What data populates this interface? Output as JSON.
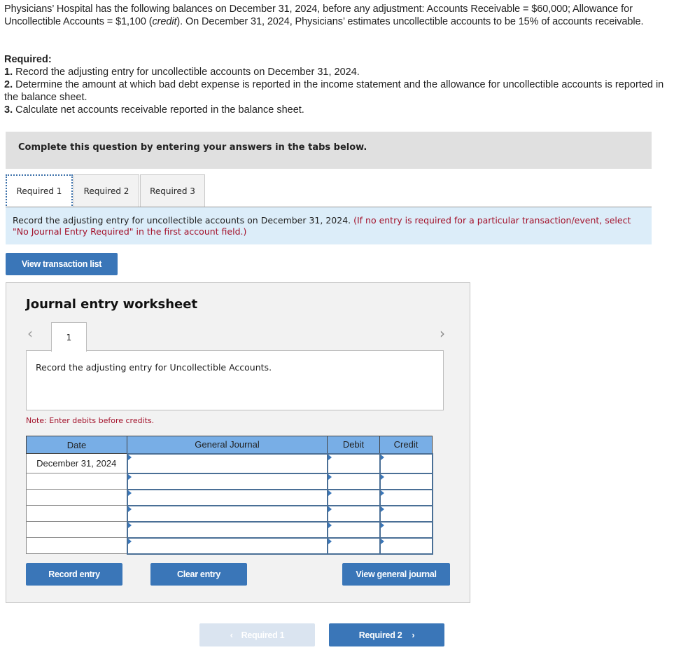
{
  "problem": {
    "text_before_italic": "Physicians’ Hospital has the following balances on December 31, 2024, before any adjustment: Accounts Receivable = $60,000; Allowance for Uncollectible Accounts = $1,100 (",
    "italic": "credit",
    "text_after_italic": "). On December 31, 2024, Physicians’ estimates uncollectible accounts to be 15% of accounts receivable."
  },
  "required": {
    "heading": "Required:",
    "items": [
      {
        "num": "1.",
        "text": " Record the adjusting entry for uncollectible accounts on December 31, 2024."
      },
      {
        "num": "2.",
        "text": " Determine the amount at which bad debt expense is reported in the income statement and the allowance for uncollectible accounts is reported in the balance sheet."
      },
      {
        "num": "3.",
        "text": " Calculate net accounts receivable reported in the balance sheet."
      }
    ]
  },
  "instruction_bar": "Complete this question by entering your answers in the tabs below.",
  "tabs": [
    {
      "label": "Required 1",
      "active": true
    },
    {
      "label": "Required 2",
      "active": false
    },
    {
      "label": "Required 3",
      "active": false
    }
  ],
  "prompt": {
    "text": "Record the adjusting entry for uncollectible accounts on December 31, 2024. ",
    "red_text": "(If no entry is required for a particular transaction/event, select \"No Journal Entry Required\" in the first account field.)"
  },
  "view_transaction_list": "View transaction list",
  "worksheet": {
    "title": "Journal entry worksheet",
    "prev_icon": "‹",
    "next_icon": "›",
    "page_tab": "1",
    "description": "Record the adjusting entry for Uncollectible Accounts.",
    "note": "Note: Enter debits before credits.",
    "table": {
      "headers": [
        "Date",
        "General Journal",
        "Debit",
        "Credit"
      ],
      "rows": [
        {
          "date": "December 31, 2024",
          "account": "",
          "debit": "",
          "credit": ""
        },
        {
          "date": "",
          "account": "",
          "debit": "",
          "credit": ""
        },
        {
          "date": "",
          "account": "",
          "debit": "",
          "credit": ""
        },
        {
          "date": "",
          "account": "",
          "debit": "",
          "credit": ""
        },
        {
          "date": "",
          "account": "",
          "debit": "",
          "credit": ""
        },
        {
          "date": "",
          "account": "",
          "debit": "",
          "credit": ""
        }
      ]
    },
    "buttons": {
      "record": "Record entry",
      "clear": "Clear entry",
      "view_journal": "View general journal"
    }
  },
  "nav": {
    "prev": {
      "label": "Required 1",
      "icon": "‹",
      "enabled": false
    },
    "next": {
      "label": "Required 2",
      "icon": "›",
      "enabled": true
    }
  },
  "colors": {
    "button_blue": "#3a76b8",
    "header_blue": "#78aee6",
    "prompt_bg": "#dcedf9",
    "note_red": "#a3112a"
  }
}
